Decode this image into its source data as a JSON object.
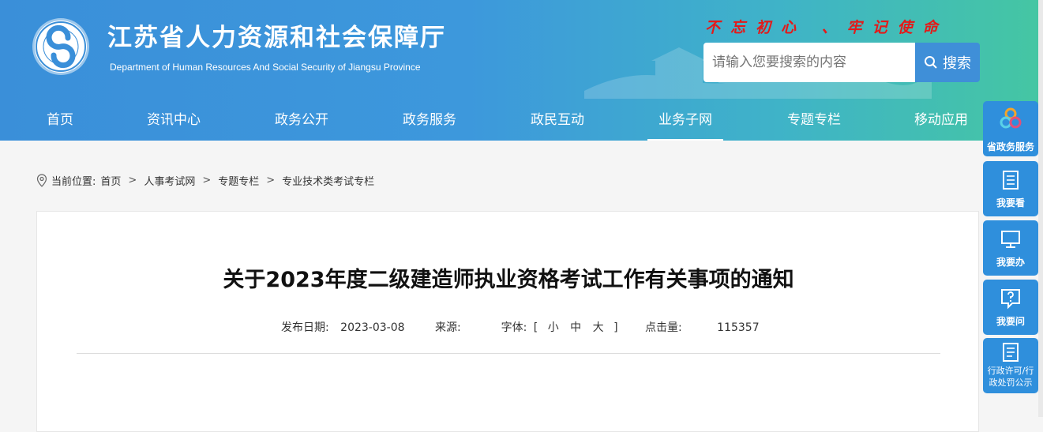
{
  "header": {
    "title": "江苏省人力资源和社会保障厅",
    "subtitle": "Department of Human Resources And Social Security of Jiangsu Province",
    "logo_text": "江苏省人力资源和社会保障厅",
    "slogan": "不忘初心 、牢记使命",
    "search_placeholder": "请输入您要搜索的内容",
    "search_button": "搜索",
    "colors": {
      "gradient_start": "#3a8fd9",
      "gradient_end": "#45c6a3",
      "slogan": "#e41919"
    }
  },
  "nav": {
    "items": [
      {
        "label": "首页"
      },
      {
        "label": "资讯中心"
      },
      {
        "label": "政务公开"
      },
      {
        "label": "政务服务"
      },
      {
        "label": "政民互动"
      },
      {
        "label": "业务子网"
      },
      {
        "label": "专题专栏"
      },
      {
        "label": "移动应用"
      }
    ],
    "active": "业务子网"
  },
  "breadcrumb": {
    "prefix": "当前位置:",
    "items": [
      "首页",
      "人事考试网",
      "专题专栏",
      "专业技术类考试专栏"
    ],
    "separator": ">"
  },
  "article": {
    "title": "关于2023年度二级建造师执业资格考试工作有关事项的通知",
    "date_label": "发布日期:",
    "date": "2023-03-08",
    "source_label": "来源:",
    "source": "",
    "font_label": "字体:",
    "font_open": "[",
    "font_small": "小",
    "font_medium": "中",
    "font_large": "大",
    "font_close": "]",
    "clicks_label": "点击量:",
    "clicks": "115357"
  },
  "sidebar": {
    "items": [
      {
        "label": "省政务服务",
        "icon": "gov-service-logo-icon"
      },
      {
        "label": "我要看",
        "icon": "document-list-icon"
      },
      {
        "label": "我要办",
        "icon": "monitor-icon"
      },
      {
        "label": "我要问",
        "icon": "question-icon"
      },
      {
        "label": "行政许可/行政处罚公示",
        "label_line1": "行政许可/行",
        "label_line2": "政处罚公示",
        "icon": "notice-list-icon"
      }
    ]
  }
}
